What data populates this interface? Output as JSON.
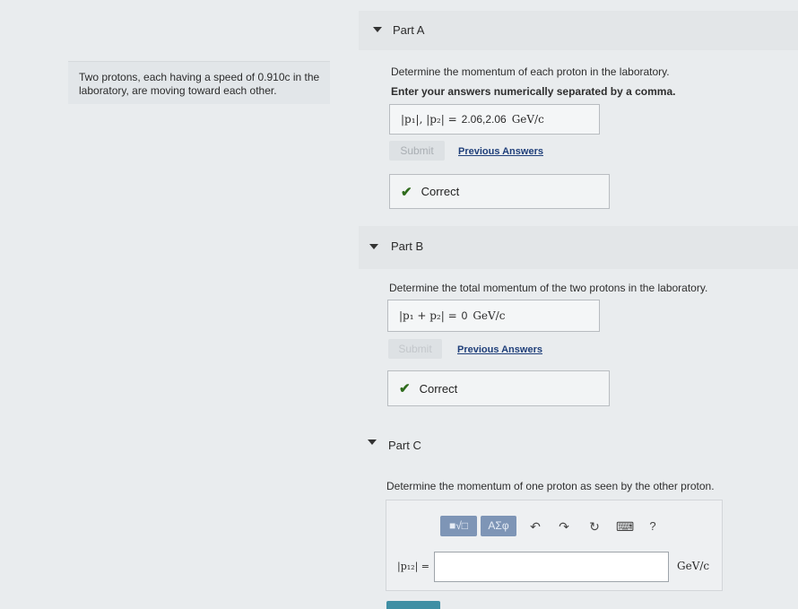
{
  "problem": {
    "line1": "Two protons, each having a speed of 0.910c in the",
    "line2": "laboratory, are moving toward each other."
  },
  "partA": {
    "title": "Part A",
    "prompt": "Determine the momentum of each proton in the laboratory.",
    "instruction": "Enter your answers numerically separated by a comma.",
    "answer_label": "|p₁|, |p₂| =",
    "answer_value": "2.06,2.06",
    "answer_unit": "GeV/c",
    "submit_label": "Submit",
    "previous_label": "Previous Answers",
    "feedback": "Correct"
  },
  "partB": {
    "title": "Part B",
    "prompt": "Determine the total momentum of the two protons in the laboratory.",
    "answer_label": "|p₁ + p₂| =",
    "answer_value": "0",
    "answer_unit": "GeV/c",
    "submit_label": "Submit",
    "previous_label": "Previous Answers",
    "feedback": "Correct"
  },
  "partC": {
    "title": "Part C",
    "prompt": "Determine the momentum of one proton as seen by the other proton.",
    "toolbar": {
      "templates_label": "■√□",
      "symbols_label": "ΑΣφ",
      "undo_icon": "↶",
      "redo_icon": "↷",
      "reset_icon": "↻",
      "keyboard_icon": "⌨",
      "help_icon": "?"
    },
    "answer_label": "|p₁₂| =",
    "answer_unit": "GeV/c"
  }
}
